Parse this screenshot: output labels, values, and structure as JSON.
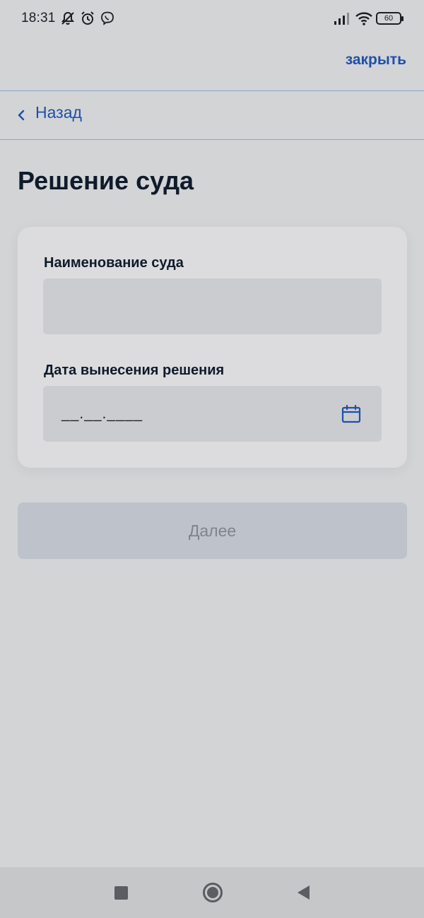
{
  "status_bar": {
    "time": "18:31",
    "icons": [
      "bell-off-icon",
      "alarm-icon",
      "viber-icon",
      "signal-icon",
      "wifi-icon"
    ],
    "battery": "60"
  },
  "header": {
    "close_label": "закрыть",
    "back_label": "Назад"
  },
  "page": {
    "title": "Решение суда"
  },
  "form": {
    "court_name_label": "Наименование суда",
    "court_name_value": "",
    "date_label": "Дата вынесения решения",
    "date_mask": "__.__.____"
  },
  "actions": {
    "next_label": "Далее"
  },
  "colors": {
    "accent": "#1f4fa8",
    "background": "#d2d4d6",
    "card": "#dcdcde",
    "input": "#cbccd0",
    "button_disabled": "#bec2cb"
  }
}
